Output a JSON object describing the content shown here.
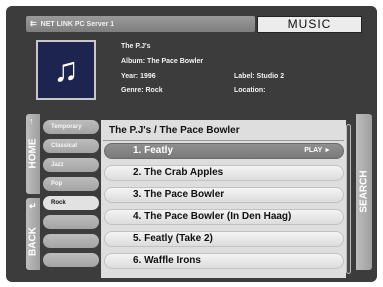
{
  "header": {
    "server_name": "NET LINK PC Server 1",
    "mode_label": "MUSIC"
  },
  "album_art": {
    "icon": "music-note-icon",
    "glyph": "♫"
  },
  "info": {
    "artist": "The P.J's",
    "album": "Album: The Pace Bowler",
    "year": "Year: 1996",
    "genre": "Genre: Rock",
    "label": "Label: Studio 2",
    "location": "Location:"
  },
  "nav": {
    "home_label": "HOME",
    "home_arrow": "↑",
    "back_label": "BACK",
    "back_arrow": "↵",
    "search_label": "SEARCH"
  },
  "genres": [
    "Temporary",
    "Classical",
    "Jazz",
    "Pop",
    "Rock",
    "",
    "",
    ""
  ],
  "active_genre": "Rock",
  "list": {
    "title": "The P.J's / The Pace Bowler",
    "play_label": "PLAY ►",
    "selected_index": 0,
    "tracks": [
      "1. Featly",
      "2. The Crab Apples",
      "3. The Pace Bowler",
      "4. The Pace Bowler (In Den Haag)",
      "5. Featly (Take 2)",
      "6. Waffle Irons"
    ]
  }
}
